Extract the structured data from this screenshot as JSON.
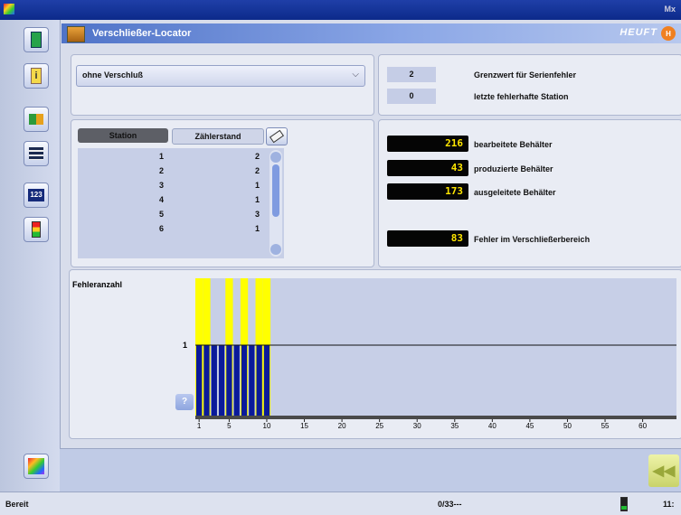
{
  "window": {
    "top_right_text": "Mx"
  },
  "left_toolbar": {
    "icons": [
      "door-icon",
      "info-icon",
      "blocks-icon",
      "list-icon",
      "counter-icon",
      "signal-light-icon"
    ],
    "bottom_icon": "color-palette-icon"
  },
  "header": {
    "title": "Verschließer-Locator",
    "brand": "HEUFT",
    "brand_badge": "H"
  },
  "filter": {
    "selected": "ohne Verschluß"
  },
  "thresholds": [
    {
      "value": "2",
      "label": "Grenzwert für Serienfehler"
    },
    {
      "value": "0",
      "label": "letzte fehlerhafte Station"
    }
  ],
  "station_table": {
    "tabs": [
      "Station",
      "Zählerstand"
    ],
    "rows": [
      {
        "station": "1",
        "count": "2"
      },
      {
        "station": "2",
        "count": "2"
      },
      {
        "station": "3",
        "count": "1"
      },
      {
        "station": "4",
        "count": "1"
      },
      {
        "station": "5",
        "count": "3"
      },
      {
        "station": "6",
        "count": "1"
      }
    ]
  },
  "counters": [
    {
      "value": "216",
      "label": "bearbeitete Behälter"
    },
    {
      "value": "43",
      "label": "produzierte Behälter"
    },
    {
      "value": "173",
      "label": "ausgeleitete Behälter"
    },
    {
      "value": "83",
      "label": "Fehler im Verschließerbereich"
    }
  ],
  "help_label": "?",
  "chart_data": {
    "type": "bar",
    "ylabel": "Fehleranzahl",
    "y_ticks": [
      "1"
    ],
    "xlim": [
      1,
      64
    ],
    "x_ticks": [
      "1",
      "5",
      "10",
      "15",
      "20",
      "25",
      "30",
      "35",
      "40",
      "45",
      "50",
      "55",
      "60"
    ],
    "threshold_line": 1,
    "highlighted_stations": [
      1,
      2,
      5,
      7,
      9,
      10
    ],
    "stations": [
      1,
      2,
      3,
      4,
      5,
      6,
      7,
      8,
      9,
      10
    ],
    "values": [
      2,
      2,
      1,
      1,
      3,
      1,
      1,
      1,
      2,
      2
    ],
    "colors": {
      "bar": "#0a1a9a",
      "highlight": "#ffff00",
      "background": "#c7cfe7"
    }
  },
  "statusbar": {
    "left": "Bereit",
    "center": "0/33---",
    "right": "11:"
  }
}
